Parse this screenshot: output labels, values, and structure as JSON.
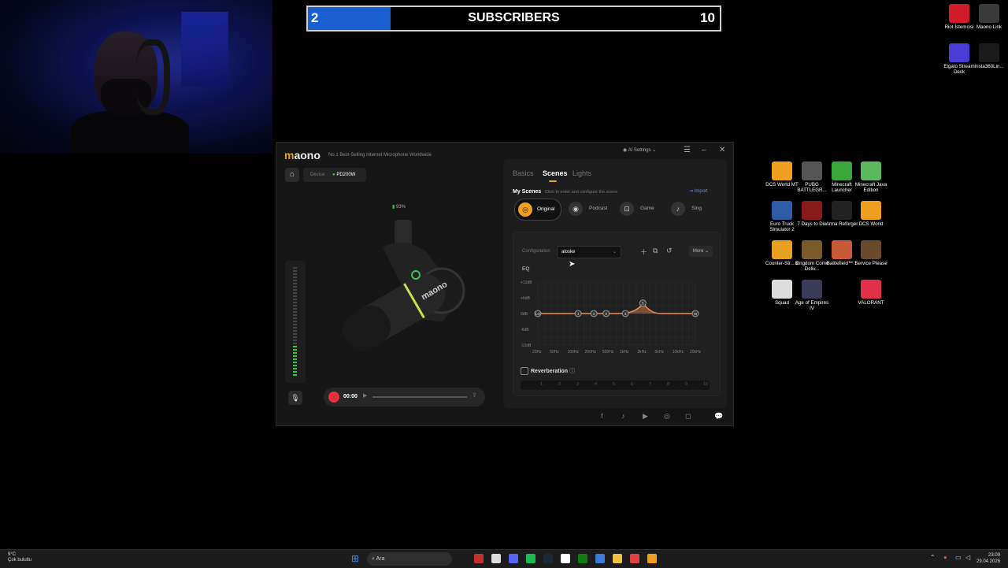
{
  "overlay": {
    "subscribers_current": "2",
    "subscribers_label": "SUBSCRIBERS",
    "subscribers_goal": "10",
    "progress_fraction": 0.2
  },
  "desktop_icons": [
    {
      "label": "Riot İstemcisi",
      "color": "#d01c2a"
    },
    {
      "label": "Maono Link",
      "color": "#3a3a3a"
    },
    {
      "label": "Elgato Stream Deck",
      "color": "#4b3bd6"
    },
    {
      "label": "Insta360Lin...",
      "color": "#1a1a1a"
    },
    {
      "label": "DCS World MT",
      "color": "#f0a020"
    },
    {
      "label": "PUBG BATTLEGR...",
      "color": "#555555"
    },
    {
      "label": "Minecraft Launcher",
      "color": "#3aa53a"
    },
    {
      "label": "Minecraft Java Edition",
      "color": "#5cb85c"
    },
    {
      "label": "Euro Truck Simulator 2",
      "color": "#2d5ca8"
    },
    {
      "label": "7 Days to Die",
      "color": "#8a1a1a"
    },
    {
      "label": "Arma Reforger",
      "color": "#222222"
    },
    {
      "label": "DCS World",
      "color": "#f0a020"
    },
    {
      "label": "Counter-Str... 2",
      "color": "#e8a020"
    },
    {
      "label": "Kingdom Come Deliv...",
      "color": "#7a5a2a"
    },
    {
      "label": "Battlefield™ 1",
      "color": "#c85a3a"
    },
    {
      "label": "Service Please",
      "color": "#6a4a2a"
    },
    {
      "label": "Squad",
      "color": "#dddddd"
    },
    {
      "label": "Age of Empires IV",
      "color": "#3a3a5a"
    },
    {
      "label": "VALORANT",
      "color": "#e0304a"
    }
  ],
  "app": {
    "logo_prefix": "m",
    "logo_rest": "aono",
    "tagline": "No.1 Best-Selling Internet Microphone Worldwide",
    "ai_settings": "AI Settings",
    "device_label": "Device",
    "device_name": "PD200W",
    "battery": "93%",
    "rec_time": "00:00",
    "tabs": [
      "Basics",
      "Scenes",
      "Lights"
    ],
    "my_scenes": "My Scenes",
    "my_scenes_hint": "Click to enter and configure the scene",
    "import": "Import",
    "scenes": [
      "Original",
      "Podcast",
      "Game",
      "Sing"
    ],
    "configuration_label": "Configuration",
    "configuration_value": "aloske",
    "more": "More",
    "eq_label": "EQ",
    "reverb_label": "Reverberation",
    "reverb_steps": [
      "1",
      "2",
      "3",
      "4",
      "5",
      "6",
      "7",
      "8",
      "9",
      "10"
    ]
  },
  "eq": {
    "y_ticks": [
      "+12dB",
      "+6dB",
      "0dB",
      "-6dB",
      "-12dB"
    ],
    "x_ticks": [
      "20Hz",
      "50Hz",
      "100Hz",
      "200Hz",
      "500Hz",
      "1kHz",
      "2kHz",
      "5kHz",
      "10kHz",
      "20kHz"
    ],
    "nodes": [
      {
        "label": "LO",
        "freq_index": 0,
        "gain_db": 0
      },
      {
        "label": "1",
        "freq_index": 2.3,
        "gain_db": 0
      },
      {
        "label": "2",
        "freq_index": 3.2,
        "gain_db": 0
      },
      {
        "label": "3",
        "freq_index": 3.9,
        "gain_db": 0
      },
      {
        "label": "4",
        "freq_index": 5.0,
        "gain_db": 0
      },
      {
        "label": "5",
        "freq_index": 6.0,
        "gain_db": 4
      },
      {
        "label": "HI",
        "freq_index": 9,
        "gain_db": 0
      }
    ]
  },
  "taskbar": {
    "search_placeholder": "Ara",
    "weather_temp": "9°C",
    "weather_desc": "Çok bulutlu",
    "time": "23:09",
    "date": "29.04.2026"
  }
}
